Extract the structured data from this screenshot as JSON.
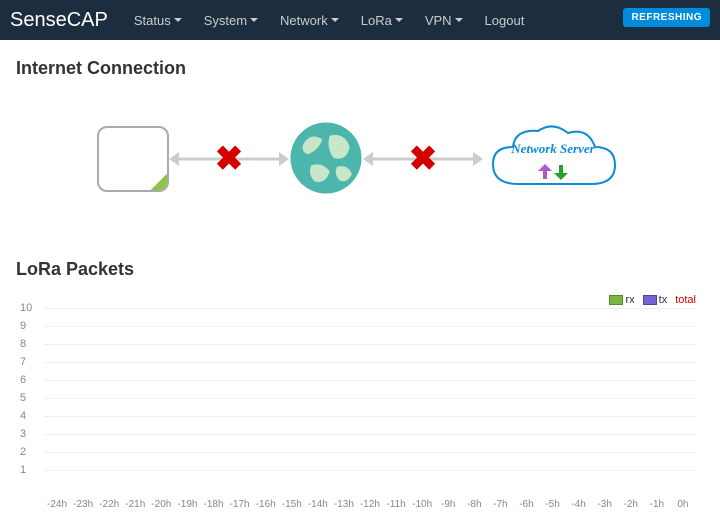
{
  "nav": {
    "brand": "SenseCAP",
    "items": [
      "Status",
      "System",
      "Network",
      "LoRa",
      "VPN"
    ],
    "logout": "Logout",
    "refresh": "REFRESHING"
  },
  "sections": {
    "internet_title": "Internet Connection",
    "lora_title": "LoRa Packets"
  },
  "connection": {
    "device_to_internet_ok": false,
    "internet_to_server_ok": false,
    "cloud_label": "Network Server",
    "fail_mark": "✖"
  },
  "legend": {
    "rx": "rx",
    "tx": "tx",
    "total": "total"
  },
  "chart_data": {
    "type": "bar",
    "title": "LoRa Packets",
    "xlabel": "",
    "ylabel": "",
    "ylim": [
      0,
      10
    ],
    "yticks": [
      1,
      2,
      3,
      4,
      5,
      6,
      7,
      8,
      9,
      10
    ],
    "categories": [
      "-24h",
      "-23h",
      "-22h",
      "-21h",
      "-20h",
      "-19h",
      "-18h",
      "-17h",
      "-16h",
      "-15h",
      "-14h",
      "-13h",
      "-12h",
      "-11h",
      "-10h",
      "-9h",
      "-8h",
      "-7h",
      "-6h",
      "-5h",
      "-4h",
      "-3h",
      "-2h",
      "-1h",
      "0h"
    ],
    "series": [
      {
        "name": "rx",
        "color": "#7cb342",
        "values": [
          0,
          0,
          0,
          0,
          0,
          0,
          0,
          0,
          0,
          0,
          0,
          0,
          0,
          0,
          0,
          0,
          0,
          0,
          0,
          0,
          0,
          0,
          0,
          0,
          0
        ]
      },
      {
        "name": "tx",
        "color": "#7962d5",
        "values": [
          0,
          0,
          0,
          0,
          0,
          0,
          0,
          0,
          0,
          0,
          0,
          0,
          0,
          0,
          0,
          0,
          0,
          0,
          0,
          0,
          0,
          0,
          0,
          0,
          0
        ]
      },
      {
        "name": "total",
        "color": "#d40000",
        "values": [
          0,
          0,
          0,
          0,
          0,
          0,
          0,
          0,
          0,
          0,
          0,
          0,
          0,
          0,
          0,
          0,
          0,
          0,
          0,
          0,
          0,
          0,
          0,
          0,
          0
        ]
      }
    ]
  }
}
